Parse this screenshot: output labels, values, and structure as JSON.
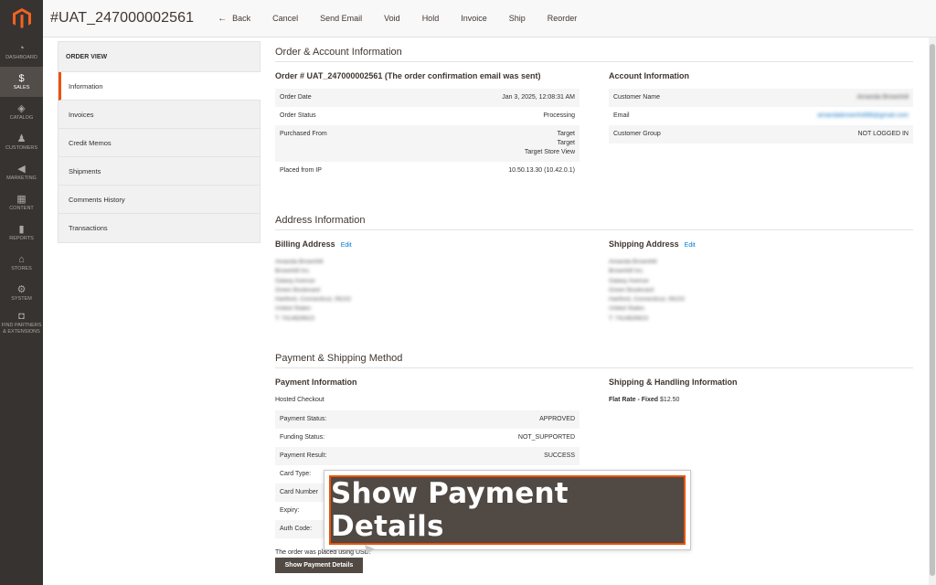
{
  "sidebar": {
    "logo": "magento-logo",
    "items": [
      {
        "label": "DASHBOARD",
        "icon": "speedometer-icon",
        "glyph": "◔"
      },
      {
        "label": "SALES",
        "icon": "dollar-icon",
        "glyph": "$"
      },
      {
        "label": "CATALOG",
        "icon": "cube-icon",
        "glyph": "◈"
      },
      {
        "label": "CUSTOMERS",
        "icon": "person-icon",
        "glyph": "♟"
      },
      {
        "label": "MARKETING",
        "icon": "megaphone-icon",
        "glyph": "◀"
      },
      {
        "label": "CONTENT",
        "icon": "layout-icon",
        "glyph": "▦"
      },
      {
        "label": "REPORTS",
        "icon": "bar-chart-icon",
        "glyph": "▮"
      },
      {
        "label": "STORES",
        "icon": "store-icon",
        "glyph": "⌂"
      },
      {
        "label": "SYSTEM",
        "icon": "gear-icon",
        "glyph": "⚙"
      },
      {
        "label": "FIND PARTNERS & EXTENSIONS",
        "icon": "box-icon",
        "glyph": "◘"
      }
    ],
    "active_index": 1
  },
  "header": {
    "title": "#UAT_247000002561",
    "buttons": [
      "Back",
      "Cancel",
      "Send Email",
      "Void",
      "Hold",
      "Invoice",
      "Ship",
      "Reorder"
    ]
  },
  "tabs": {
    "heading": "ORDER VIEW",
    "items": [
      "Information",
      "Invoices",
      "Credit Memos",
      "Shipments",
      "Comments History",
      "Transactions"
    ]
  },
  "order_account": {
    "section_title": "Order & Account Information",
    "order_heading": "Order # UAT_247000002561 (The order confirmation email was sent)",
    "order_rows": [
      {
        "label": "Order Date",
        "value": "Jan 3, 2025, 12:08:31 AM"
      },
      {
        "label": "Order Status",
        "value": "Processing"
      },
      {
        "label": "Purchased From",
        "value_lines": [
          "Target",
          "Target",
          "Target Store View"
        ]
      },
      {
        "label": "Placed from IP",
        "value": "10.50.13.30 (10.42.0.1)"
      }
    ],
    "account_heading": "Account Information",
    "account_rows": [
      {
        "label": "Customer Name",
        "value": "Amanda Brownhill"
      },
      {
        "label": "Email",
        "value": "amandabrownhill98@gmail.com"
      },
      {
        "label": "Customer Group",
        "value": "NOT LOGGED IN"
      }
    ]
  },
  "address": {
    "section_title": "Address Information",
    "billing_heading": "Billing Address",
    "shipping_heading": "Shipping Address",
    "edit_label": "Edit",
    "billing_lines": [
      "Amanda Brownhill",
      "Brownhill Inc.",
      "Galaxy Avenue",
      "Green Boulevard",
      "Hartford, Connecticut, 06102",
      "United States",
      "T: 7414826623"
    ],
    "shipping_lines": [
      "Amanda Brownhill",
      "Brownhill Inc.",
      "Galaxy Avenue",
      "Green Boulevard",
      "Hartford, Connecticut, 06102",
      "United States",
      "T: 7414826623"
    ]
  },
  "payment": {
    "section_title": "Payment & Shipping Method",
    "payment_heading": "Payment Information",
    "method": "Hosted Checkout",
    "rows": [
      {
        "label": "Payment Status:",
        "value": "APPROVED"
      },
      {
        "label": "Funding Status:",
        "value": "NOT_SUPPORTED"
      },
      {
        "label": "Payment Result:",
        "value": "SUCCESS"
      },
      {
        "label": "Card Type:",
        "value": ""
      },
      {
        "label": "Card Number",
        "value": ""
      },
      {
        "label": "Expiry:",
        "value": ""
      },
      {
        "label": "Auth Code:",
        "value": ""
      }
    ],
    "currency_note": "The order was placed using USD.",
    "show_details_button": "Show Payment Details",
    "shipping_heading": "Shipping & Handling Information",
    "shipping_method_bold": "Flat Rate - Fixed",
    "shipping_price": "$12.50"
  },
  "callout": {
    "text": "Show Payment Details"
  }
}
